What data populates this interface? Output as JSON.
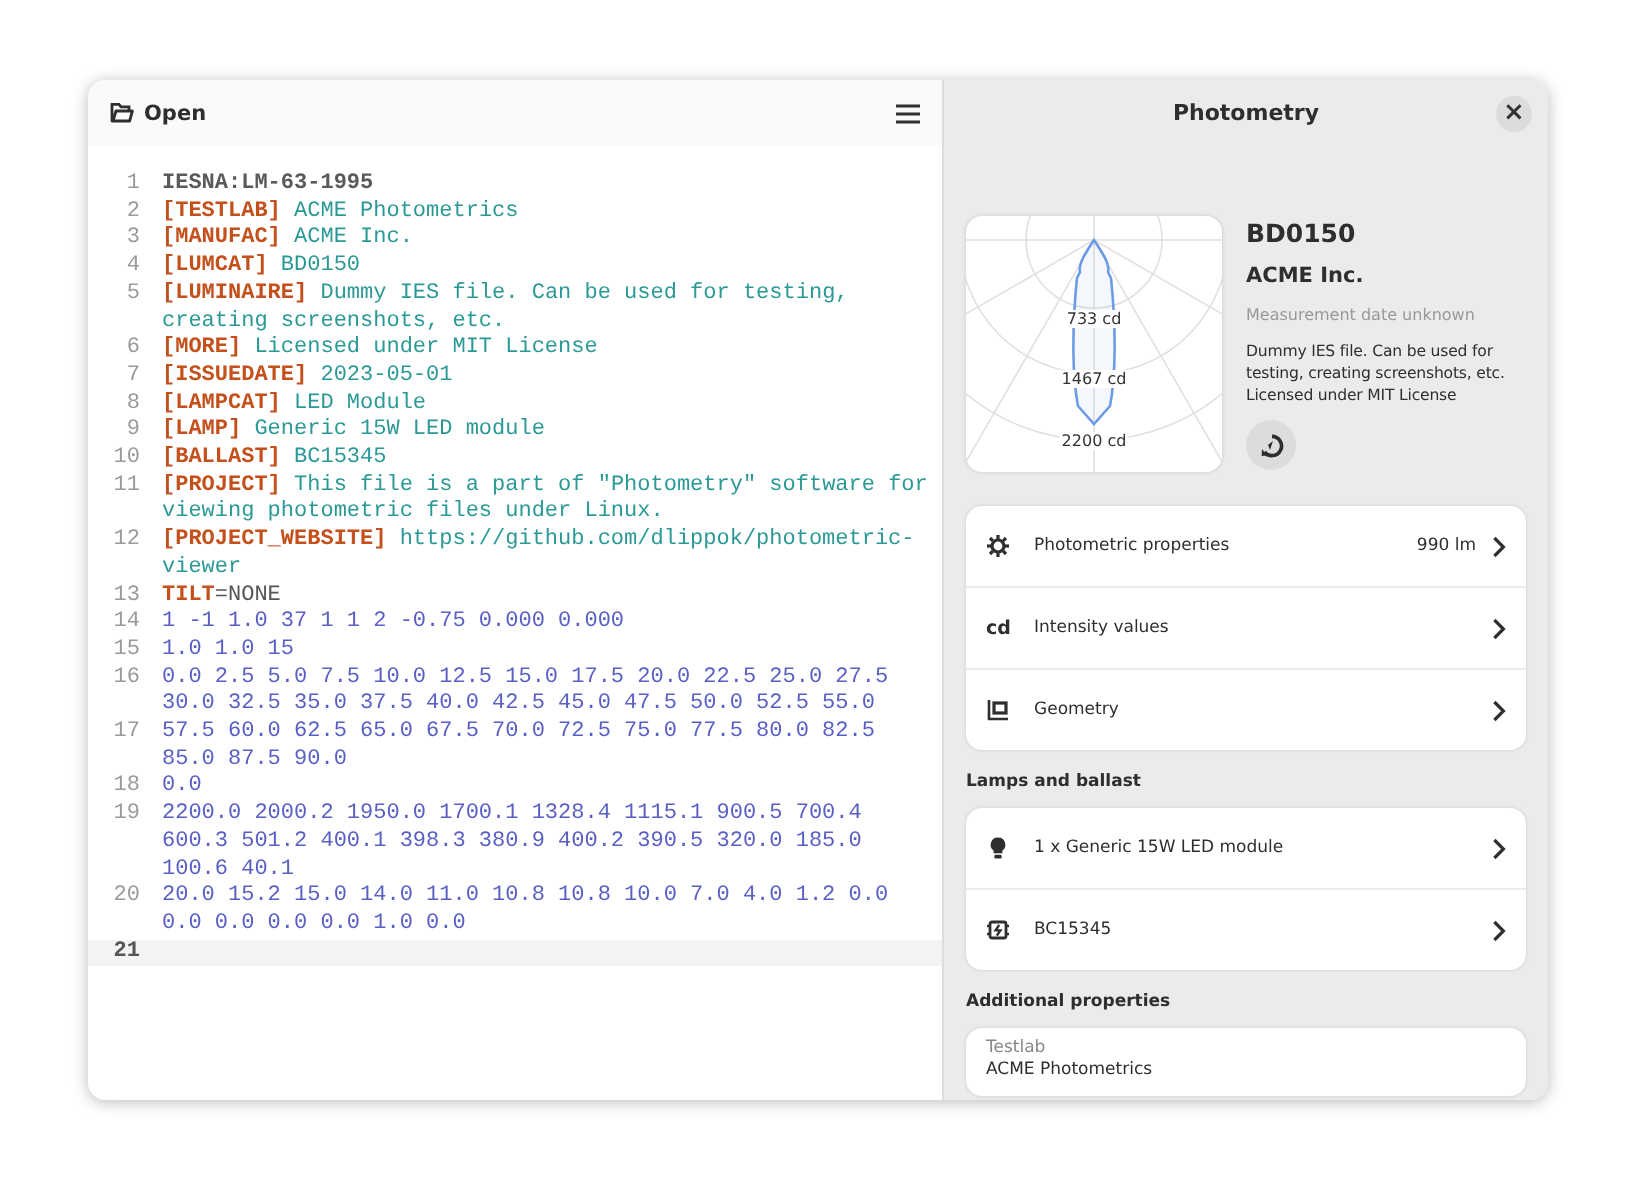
{
  "toolbar": {
    "open_label": "Open"
  },
  "editor": {
    "lines": [
      {
        "number": "1",
        "current": false,
        "parts": [
          {
            "kind": "header",
            "text": "IESNA:LM-63-1995"
          }
        ]
      },
      {
        "number": "2",
        "current": false,
        "parts": [
          {
            "kind": "keyword",
            "text": "[TESTLAB]"
          },
          {
            "kind": "value",
            "text": " ACME Photometrics"
          }
        ]
      },
      {
        "number": "3",
        "current": false,
        "parts": [
          {
            "kind": "keyword",
            "text": "[MANUFAC]"
          },
          {
            "kind": "value",
            "text": " ACME Inc."
          }
        ]
      },
      {
        "number": "4",
        "current": false,
        "parts": [
          {
            "kind": "keyword",
            "text": "[LUMCAT]"
          },
          {
            "kind": "value",
            "text": " BD0150"
          }
        ]
      },
      {
        "number": "5",
        "current": false,
        "parts": [
          {
            "kind": "keyword",
            "text": "[LUMINAIRE]"
          },
          {
            "kind": "value",
            "text": " Dummy IES file. Can be used for testing, creating screenshots, etc."
          }
        ]
      },
      {
        "number": "6",
        "current": false,
        "parts": [
          {
            "kind": "keyword",
            "text": "[MORE]"
          },
          {
            "kind": "value",
            "text": " Licensed under MIT License"
          }
        ]
      },
      {
        "number": "7",
        "current": false,
        "parts": [
          {
            "kind": "keyword",
            "text": "[ISSUEDATE]"
          },
          {
            "kind": "value",
            "text": " 2023-05-01"
          }
        ]
      },
      {
        "number": "8",
        "current": false,
        "parts": [
          {
            "kind": "keyword",
            "text": "[LAMPCAT]"
          },
          {
            "kind": "value",
            "text": " LED Module"
          }
        ]
      },
      {
        "number": "9",
        "current": false,
        "parts": [
          {
            "kind": "keyword",
            "text": "[LAMP]"
          },
          {
            "kind": "value",
            "text": " Generic 15W LED module"
          }
        ]
      },
      {
        "number": "10",
        "current": false,
        "parts": [
          {
            "kind": "keyword",
            "text": "[BALLAST]"
          },
          {
            "kind": "value",
            "text": " BC15345"
          }
        ]
      },
      {
        "number": "11",
        "current": false,
        "parts": [
          {
            "kind": "keyword",
            "text": "[PROJECT]"
          },
          {
            "kind": "value",
            "text": " This file is a part of \"Photometry\" software for viewing photometric files under Linux."
          }
        ]
      },
      {
        "number": "12",
        "current": false,
        "parts": [
          {
            "kind": "keyword",
            "text": "[PROJECT_WEBSITE]"
          },
          {
            "kind": "value",
            "text": " https://github.com/dlippok/photometric-viewer"
          }
        ]
      },
      {
        "number": "13",
        "current": false,
        "parts": [
          {
            "kind": "keyword",
            "text": "TILT"
          },
          {
            "kind": "plain",
            "text": "=NONE"
          }
        ]
      },
      {
        "number": "14",
        "current": false,
        "parts": [
          {
            "kind": "number",
            "text": "1 -1 1.0 37 1 1 2 -0.75 0.000 0.000"
          }
        ]
      },
      {
        "number": "15",
        "current": false,
        "parts": [
          {
            "kind": "number",
            "text": "1.0 1.0 15"
          }
        ]
      },
      {
        "number": "16",
        "current": false,
        "parts": [
          {
            "kind": "number",
            "text": "0.0 2.5 5.0 7.5 10.0 12.5 15.0 17.5 20.0 22.5 25.0 27.5 30.0 32.5 35.0 37.5 40.0 42.5 45.0 47.5 50.0 52.5 55.0"
          }
        ]
      },
      {
        "number": "17",
        "current": false,
        "parts": [
          {
            "kind": "number",
            "text": "57.5 60.0 62.5 65.0 67.5 70.0 72.5 75.0 77.5 80.0 82.5 85.0 87.5 90.0"
          }
        ]
      },
      {
        "number": "18",
        "current": false,
        "parts": [
          {
            "kind": "number",
            "text": "0.0"
          }
        ]
      },
      {
        "number": "19",
        "current": false,
        "parts": [
          {
            "kind": "number",
            "text": "2200.0 2000.2 1950.0 1700.1 1328.4 1115.1 900.5 700.4 600.3 501.2 400.1 398.3 380.9 400.2 390.5 320.0 185.0 100.6 40.1"
          }
        ]
      },
      {
        "number": "20",
        "current": false,
        "parts": [
          {
            "kind": "number",
            "text": "20.0 15.2 15.0 14.0 11.0 10.8 10.8 10.0 7.0 4.0 1.2 0.0 0.0 0.0 0.0 0.0 1.0 0.0"
          }
        ]
      },
      {
        "number": "21",
        "current": true
      }
    ]
  },
  "details": {
    "title": "Photometry",
    "close": "×",
    "diagram_labels": [
      "733 cd",
      "1467 cd",
      "2200 cd"
    ],
    "name": "BD0150",
    "manufacturer": "ACME Inc.",
    "date": "Measurement date unknown",
    "description": [
      "Dummy IES file. Can be used for testing, creating screenshots, etc.",
      "Licensed under MIT License"
    ],
    "sections": [
      {
        "rows": [
          {
            "kind": "gear",
            "label": "Photometric properties",
            "value": "990 lm"
          },
          {
            "kind": "text",
            "badge": "cd",
            "label": "Intensity values"
          },
          {
            "kind": "geometry",
            "label": "Geometry"
          }
        ]
      },
      {
        "heading": "Lamps and ballast",
        "rows": [
          {
            "kind": "bulb",
            "label": "1 x Generic 15W LED module"
          },
          {
            "kind": "ballast",
            "label": "BC15345"
          }
        ]
      },
      {
        "heading": "Additional properties",
        "properties": [
          {
            "label": "Testlab",
            "value": "ACME Photometrics"
          }
        ]
      }
    ]
  }
}
